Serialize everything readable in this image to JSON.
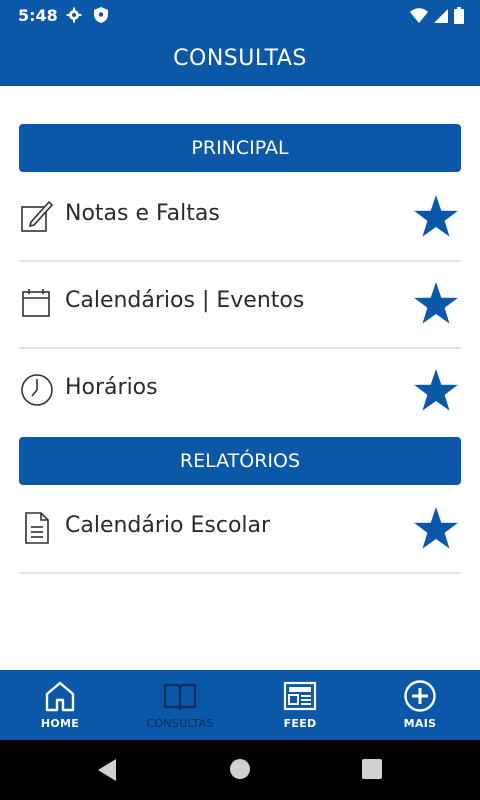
{
  "status_bar": {
    "time": "5:48"
  },
  "app_bar": {
    "title": "CONSULTAS"
  },
  "sections": {
    "principal": {
      "title": "PRINCIPAL",
      "items": [
        {
          "label": "Notas e Faltas",
          "icon": "edit-icon"
        },
        {
          "label": "Calendários | Eventos",
          "icon": "calendar-icon"
        },
        {
          "label": "Horários",
          "icon": "clock-icon"
        }
      ]
    },
    "relatorios": {
      "title": "RELATÓRIOS",
      "items": [
        {
          "label": "Calendário Escolar",
          "icon": "document-icon"
        }
      ]
    }
  },
  "bottom_nav": {
    "items": [
      {
        "label": "HOME",
        "icon": "home-icon"
      },
      {
        "label": "CONSULTAS",
        "icon": "book-icon",
        "active": true
      },
      {
        "label": "FEED",
        "icon": "newspaper-icon"
      },
      {
        "label": "MAIS",
        "icon": "plus-circle-icon"
      }
    ]
  },
  "colors": {
    "primary": "#0b57a8",
    "star": "#0b57a8",
    "active_nav_label": "#0a2d5a",
    "divider": "#e4e4e4"
  }
}
